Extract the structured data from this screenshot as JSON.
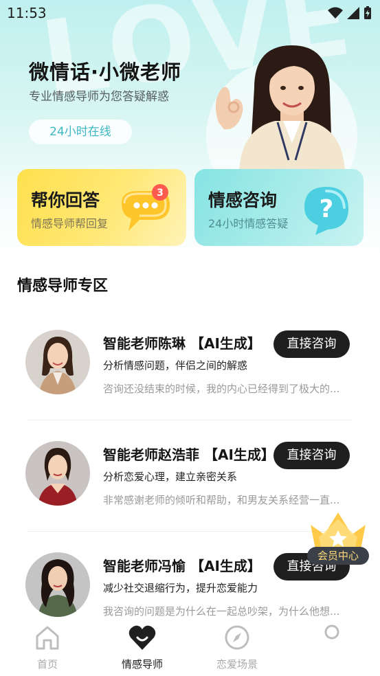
{
  "status_bar": {
    "time": "11:53"
  },
  "hero": {
    "watermark": "LOVE",
    "title": "微情话·小微老师",
    "subtitle": "专业情感导师为您答疑解惑",
    "online_label": "24小时在线"
  },
  "cards": [
    {
      "title": "帮你回答",
      "subtitle": "情感导师帮回复",
      "badge": "3",
      "icon": "chat-bubble-icon"
    },
    {
      "title": "情感咨询",
      "subtitle": "24小时情感答疑",
      "icon": "question-bubble-icon"
    }
  ],
  "section_title": "情感导师专区",
  "teachers": [
    {
      "name": "智能老师陈琳 【AI生成】",
      "desc": "分析情感问题，伴侣之间的解惑",
      "quote": "咨询还没结束的时候，我的内心已经得到了极大的...",
      "button": "直接咨询"
    },
    {
      "name": "智能老师赵浩菲 【AI生成】",
      "desc": "分析恋爱心理，建立亲密关系",
      "quote": "非常感谢老师的倾听和帮助，和男友关系经营一直...",
      "button": "直接咨询"
    },
    {
      "name": "智能老师冯愉 【AI生成】",
      "desc": "减少社交退缩行为，提升恋爱能力",
      "quote": "我咨询的问题是为什么在一起总吵架，为什么他想...",
      "button": "直接咨询"
    }
  ],
  "vip": {
    "label": "会员中心"
  },
  "tabs": [
    {
      "label": "首页",
      "icon": "home-icon",
      "active": false
    },
    {
      "label": "情感导师",
      "icon": "heart-icon",
      "active": true
    },
    {
      "label": "恋爱场景",
      "icon": "compass-icon",
      "active": false
    },
    {
      "label": "",
      "icon": "profile-icon",
      "active": false
    }
  ],
  "colors": {
    "accent_teal": "#3eb7c4",
    "yellow_card": "#ffe04e",
    "teal_card": "#87e3e3",
    "button_dark": "#1f1f1f"
  }
}
